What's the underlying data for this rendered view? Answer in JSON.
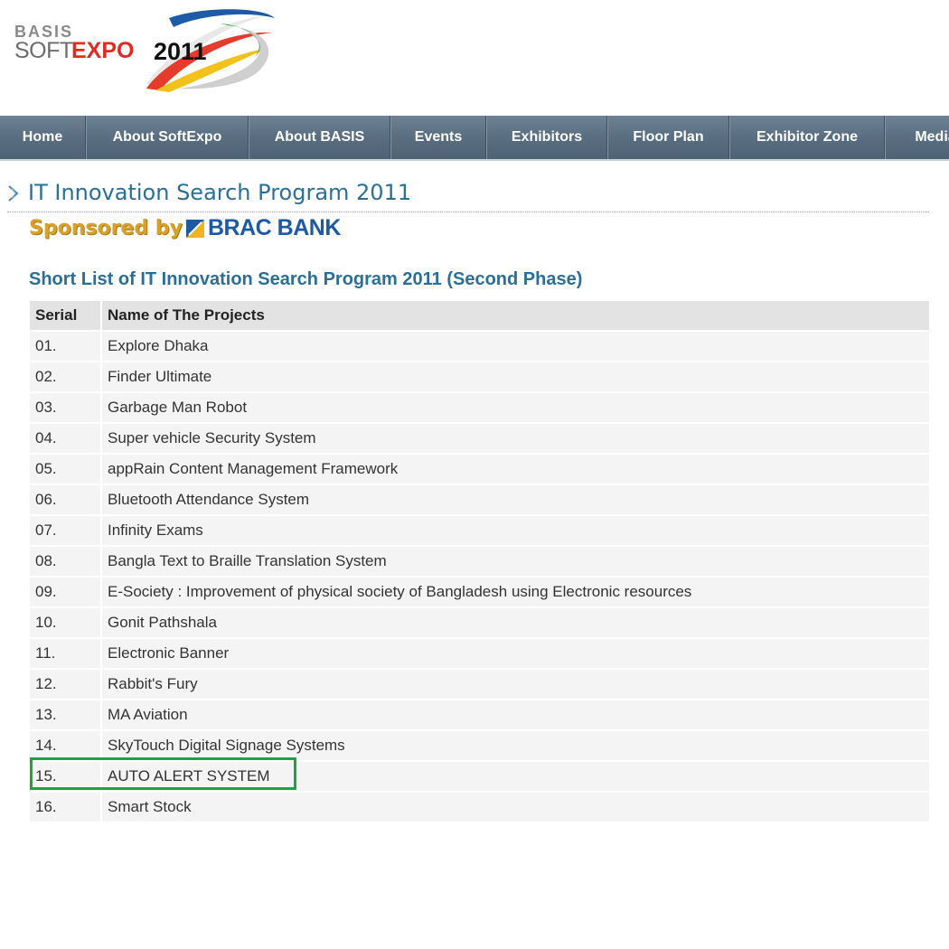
{
  "logo": {
    "line1": "BASIS",
    "soft": "SOFT",
    "expo": "EXPO",
    "year": "2011"
  },
  "nav": {
    "items": [
      "Home",
      "About SoftExpo",
      "About BASIS",
      "Events",
      "Exhibitors",
      "Floor Plan",
      "Exhibitor Zone",
      "Media"
    ]
  },
  "page_title": "IT Innovation Search Program 2011",
  "sponsor": {
    "label": "Sponsored by",
    "name": "BRAC BANK"
  },
  "list_heading": "Short List of IT Innovation Search Program 2011 (Second Phase)",
  "table": {
    "headers": [
      "Serial",
      "Name of The Projects"
    ],
    "rows": [
      [
        "01.",
        "Explore Dhaka"
      ],
      [
        "02.",
        "Finder Ultimate"
      ],
      [
        "03.",
        "Garbage Man Robot"
      ],
      [
        "04.",
        "Super vehicle Security System"
      ],
      [
        "05.",
        "appRain Content Management Framework"
      ],
      [
        "06.",
        "Bluetooth Attendance System"
      ],
      [
        "07.",
        "Infinity Exams"
      ],
      [
        "08.",
        "Bangla Text to Braille Translation System"
      ],
      [
        "09.",
        "E-Society : Improvement of physical society of Bangladesh using Electronic resources"
      ],
      [
        "10.",
        "Gonit Pathshala"
      ],
      [
        "11.",
        "Electronic Banner"
      ],
      [
        "12.",
        "Rabbit's Fury"
      ],
      [
        "13.",
        "MA Aviation"
      ],
      [
        "14.",
        "SkyTouch Digital Signage Systems"
      ],
      [
        "15.",
        "AUTO ALERT SYSTEM"
      ],
      [
        "16.",
        "Smart Stock"
      ]
    ],
    "highlighted_row": "15."
  },
  "colors": {
    "nav_bg": "#5a6e81",
    "title_blue": "#2a6f97",
    "sponsor_gold": "#d8a12b",
    "brac_blue": "#1c5aa6",
    "highlight_green": "#23a046"
  }
}
